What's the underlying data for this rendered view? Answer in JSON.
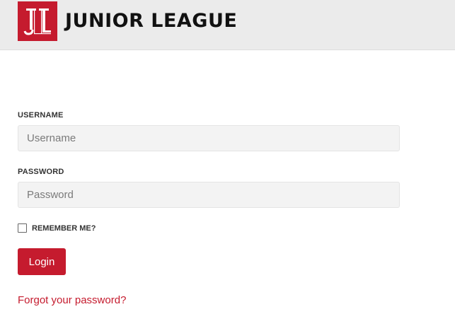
{
  "header": {
    "brand": "JUNIOR LEAGUE",
    "logo_icon": "junior-league-logo",
    "background": "#ebebeb"
  },
  "form": {
    "username_label": "USERNAME",
    "username_placeholder": "Username",
    "username_value": "",
    "password_label": "PASSWORD",
    "password_placeholder": "Password",
    "password_value": "",
    "remember_label": "REMEMBER ME?",
    "remember_checked": false,
    "login_label": "Login",
    "forgot_link": "Forgot your password?"
  },
  "colors": {
    "accent": "#c51b2e",
    "field_background": "#f3f3f3"
  }
}
